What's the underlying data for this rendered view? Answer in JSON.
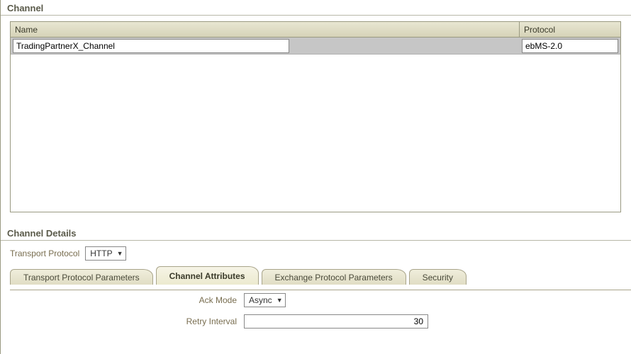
{
  "channel": {
    "section_title": "Channel",
    "columns": {
      "name": "Name",
      "protocol": "Protocol"
    },
    "row": {
      "name": "TradingPartnerX_Channel",
      "protocol": "ebMS-2.0"
    }
  },
  "details": {
    "section_title": "Channel Details",
    "transport_protocol": {
      "label": "Transport Protocol",
      "value": "HTTP"
    },
    "tabs": [
      {
        "label": "Transport Protocol Parameters"
      },
      {
        "label": "Channel Attributes"
      },
      {
        "label": "Exchange Protocol Parameters"
      },
      {
        "label": "Security"
      }
    ],
    "ack_mode": {
      "label": "Ack Mode",
      "value": "Async"
    },
    "retry_interval": {
      "label": "Retry Interval",
      "value": "30"
    }
  }
}
